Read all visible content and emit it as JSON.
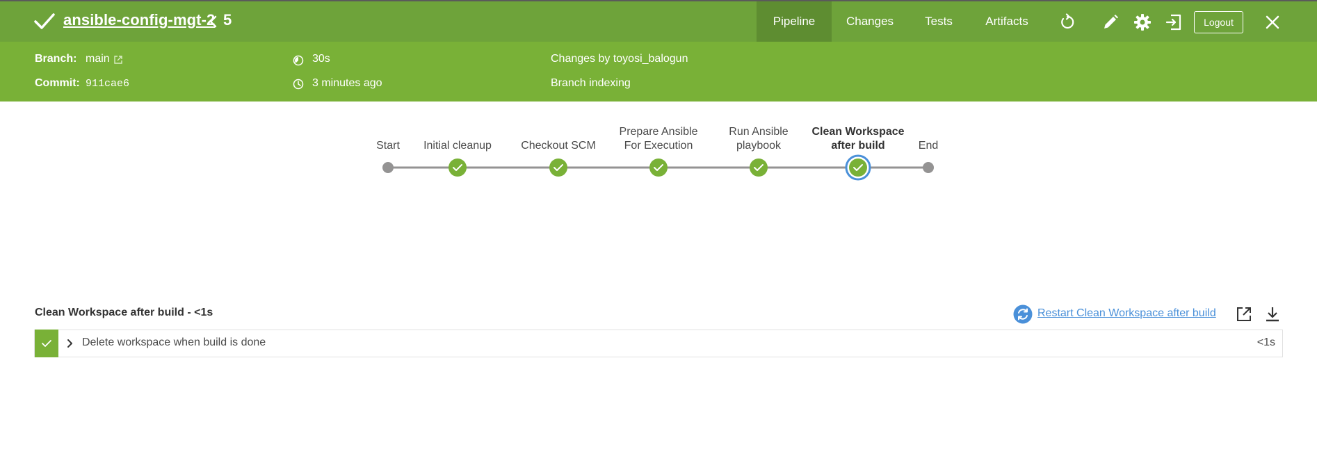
{
  "header": {
    "title": "ansible-config-mgt-2",
    "run_number": "5",
    "nav": [
      "Pipeline",
      "Changes",
      "Tests",
      "Artifacts"
    ],
    "active_tab": "Pipeline",
    "logout_label": "Logout",
    "icons": [
      "success-check-icon",
      "chevron-left-icon",
      "replay-icon",
      "edit-icon",
      "gear-icon",
      "exit-icon",
      "close-icon"
    ]
  },
  "subheader": {
    "branch_label": "Branch:",
    "branch_value": "main",
    "commit_label": "Commit:",
    "commit_value": "911cae6",
    "duration": "30s",
    "started": "3 minutes ago",
    "changes_by": "Changes by toyosi_balogun",
    "cause": "Branch indexing"
  },
  "pipeline": {
    "stages": [
      {
        "label_lines": [
          "Start"
        ],
        "status": "none"
      },
      {
        "label_lines": [
          "Initial cleanup"
        ],
        "status": "success"
      },
      {
        "label_lines": [
          "Checkout SCM"
        ],
        "status": "success"
      },
      {
        "label_lines": [
          "Prepare Ansible",
          "For Execution"
        ],
        "status": "success"
      },
      {
        "label_lines": [
          "Run Ansible",
          "playbook"
        ],
        "status": "success"
      },
      {
        "label_lines": [
          "Clean Workspace",
          "after build"
        ],
        "status": "success",
        "selected": true
      },
      {
        "label_lines": [
          "End"
        ],
        "status": "none"
      }
    ]
  },
  "log": {
    "title": "Clean Workspace after build - <1s",
    "restart_label": "Restart Clean Workspace after build",
    "steps": [
      {
        "label": "Delete workspace when build is done",
        "duration": "<1s",
        "status": "success"
      }
    ]
  },
  "colors": {
    "topbar": "#6ea33a",
    "subheader": "#79b137",
    "success": "#79b137",
    "selected_ring": "#4a90d9",
    "link": "#4a90d9",
    "node_gray": "#949393"
  }
}
